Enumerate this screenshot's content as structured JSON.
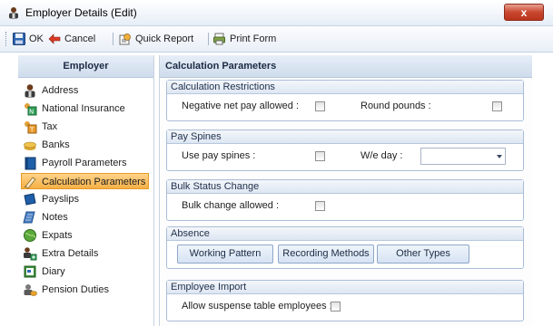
{
  "window": {
    "title": "Employer Details (Edit)",
    "close_glyph": "x"
  },
  "toolbar": {
    "ok_label": "OK",
    "cancel_label": "Cancel",
    "quick_report_label": "Quick Report",
    "print_form_label": "Print Form"
  },
  "left_panel": {
    "header": "Employer",
    "items": [
      {
        "label": "Address",
        "icon": "person-icon"
      },
      {
        "label": "National Insurance",
        "icon": "ni-icon"
      },
      {
        "label": "Tax",
        "icon": "tax-icon"
      },
      {
        "label": "Banks",
        "icon": "banks-icon"
      },
      {
        "label": "Payroll Parameters",
        "icon": "book-icon"
      },
      {
        "label": "Calculation Parameters",
        "icon": "calculator-icon",
        "selected": true
      },
      {
        "label": "Payslips",
        "icon": "payslip-icon"
      },
      {
        "label": "Notes",
        "icon": "notes-icon"
      },
      {
        "label": "Expats",
        "icon": "globe-icon"
      },
      {
        "label": "Extra Details",
        "icon": "extra-details-icon"
      },
      {
        "label": "Diary",
        "icon": "diary-icon"
      },
      {
        "label": "Pension Duties",
        "icon": "pension-icon"
      }
    ]
  },
  "right_panel": {
    "header": "Calculation Parameters",
    "calculation_restrictions": {
      "title": "Calculation Restrictions",
      "negative_net_pay_label": "Negative net pay allowed :",
      "negative_net_pay_checked": false,
      "round_pounds_label": "Round pounds :",
      "round_pounds_checked": false
    },
    "pay_spines": {
      "title": "Pay Spines",
      "use_pay_spines_label": "Use pay spines :",
      "use_pay_spines_checked": false,
      "we_day_label": "W/e day :",
      "we_day_value": ""
    },
    "bulk_status_change": {
      "title": "Bulk Status Change",
      "bulk_change_label": "Bulk change allowed :",
      "bulk_change_checked": false
    },
    "absence": {
      "title": "Absence",
      "working_pattern_label": "Working Pattern",
      "recording_methods_label": "Recording Methods",
      "other_types_label": "Other Types"
    },
    "employee_import": {
      "title": "Employee Import",
      "allow_suspense_label": "Allow suspense table employees :",
      "allow_suspense_checked": false
    }
  },
  "colors": {
    "selected_item": "#f6b046",
    "header_text": "#1b2b44",
    "close_button": "#c9472f"
  }
}
